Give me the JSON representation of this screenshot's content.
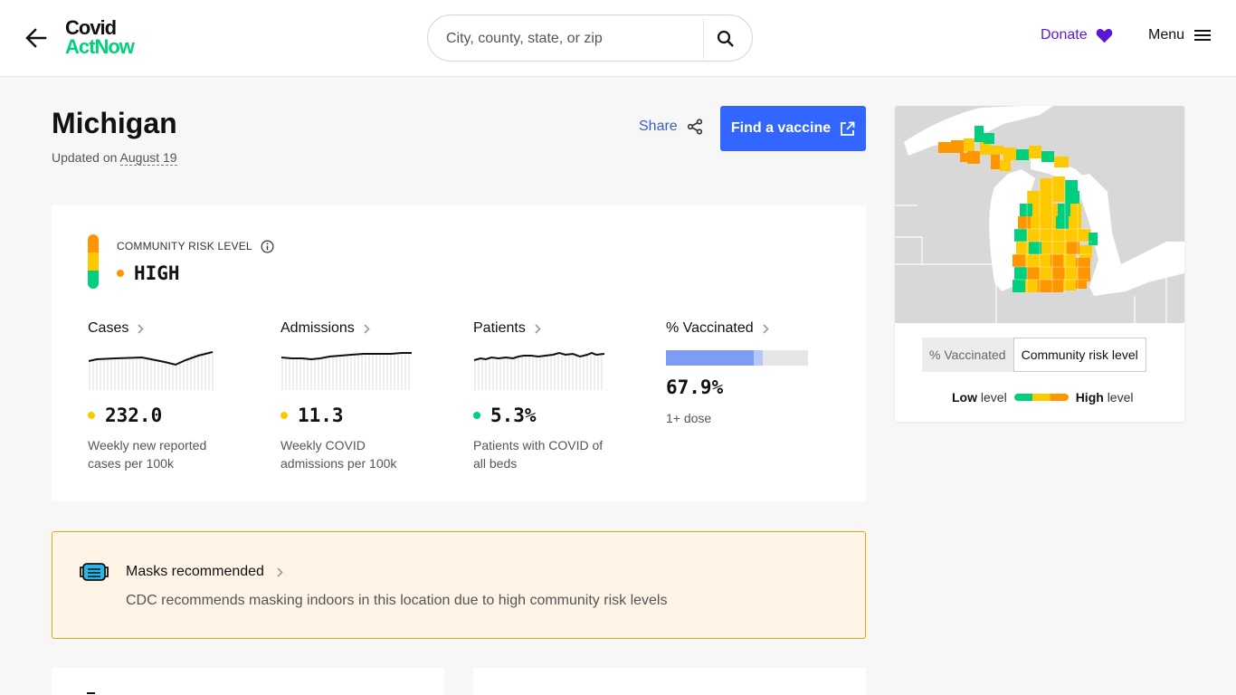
{
  "header": {
    "logo_line1": "Covid",
    "logo_line2": "ActNow",
    "search_placeholder": "City, county, state, or zip",
    "donate_label": "Donate",
    "menu_label": "Menu"
  },
  "page": {
    "title": "Michigan",
    "updated_prefix": "Updated on",
    "updated_date": "August 19",
    "share_label": "Share",
    "vaccine_button_label": "Find a vaccine"
  },
  "risk": {
    "label": "COMMUNITY RISK LEVEL",
    "value": "HIGH",
    "level_color": "#ff9600"
  },
  "metrics": [
    {
      "title": "Cases",
      "value": "232.0",
      "dot_color": "#ffc900",
      "desc": "Weekly new reported cases per 100k"
    },
    {
      "title": "Admissions",
      "value": "11.3",
      "dot_color": "#ffc900",
      "desc": "Weekly COVID admissions per 100k"
    },
    {
      "title": "Patients",
      "value": "5.3%",
      "dot_color": "#00d07d",
      "desc": "Patients with COVID of all beds"
    },
    {
      "title": "% Vaccinated",
      "value": "67.9%",
      "desc": "1+ dose",
      "fill_fraction": 0.679
    }
  ],
  "map": {
    "toggle_options": [
      "% Vaccinated",
      "Community risk level"
    ],
    "selected": "Community risk level",
    "legend_low_bold": "Low",
    "legend_low_rest": "level",
    "legend_high_bold": "High",
    "legend_high_rest": "level"
  },
  "mask": {
    "title": "Masks recommended",
    "desc": "CDC recommends masking indoors in this location due to high community risk levels"
  },
  "colors": {
    "green": "#00d07d",
    "yellow": "#ffc900",
    "orange": "#ff9600",
    "accent_blue": "#3366ff",
    "donate_purple": "#5a17d6"
  }
}
